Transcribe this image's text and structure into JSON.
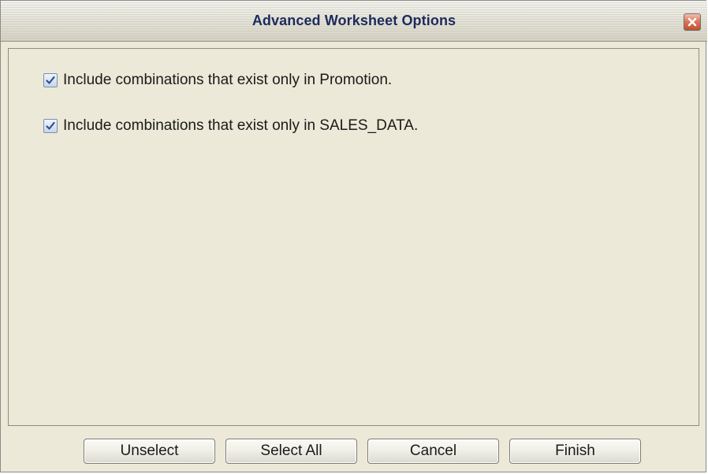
{
  "window": {
    "title": "Advanced Worksheet Options",
    "close_icon": "close-icon"
  },
  "options": [
    {
      "label": "Include combinations that exist only in Promotion.",
      "checked": true
    },
    {
      "label": "Include combinations that exist only in SALES_DATA.",
      "checked": true
    }
  ],
  "buttons": {
    "unselect": "Unselect",
    "select_all": "Select All",
    "cancel": "Cancel",
    "finish": "Finish"
  },
  "colors": {
    "title_text": "#1c2a5c",
    "panel_bg": "#ece9d8",
    "check_mark": "#2a4f8f",
    "close_button": "#c2502f"
  }
}
